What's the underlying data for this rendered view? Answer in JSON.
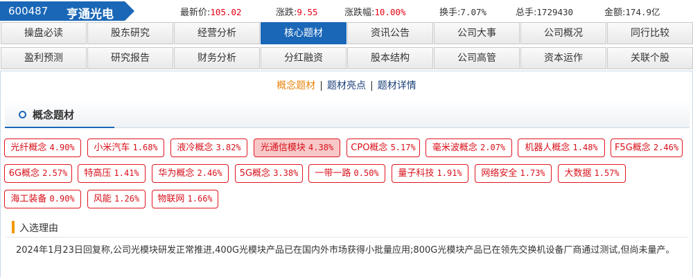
{
  "header": {
    "code": "600487",
    "name": "亨通光电",
    "quotes": [
      {
        "label": "最新价:",
        "value": "105.02",
        "color": "red"
      },
      {
        "label": "涨跌:",
        "value": "9.55",
        "color": "red"
      },
      {
        "label": "涨跌幅:",
        "value": "10.00%",
        "color": "red"
      },
      {
        "label": "换手:",
        "value": "7.07%",
        "color": "dark"
      },
      {
        "label": "总手:",
        "value": "1729430",
        "color": "dark"
      },
      {
        "label": "金额:",
        "value": "174.9亿",
        "color": "dark"
      }
    ]
  },
  "nav": {
    "row1": [
      "操盘必读",
      "股东研究",
      "经营分析",
      "核心题材",
      "资讯公告",
      "公司大事",
      "公司概况",
      "同行比较"
    ],
    "row2": [
      "盈利预测",
      "研究报告",
      "财务分析",
      "分红融资",
      "股本结构",
      "公司高管",
      "资本运作",
      "关联个股"
    ],
    "active": "核心题材"
  },
  "subnav": {
    "items": [
      "概念题材",
      "题材亮点",
      "题材详情"
    ],
    "separator": "|",
    "active": "概念题材"
  },
  "section": {
    "title": "概念题材"
  },
  "tags": [
    {
      "name": "光纤概念",
      "pct": "4.90%"
    },
    {
      "name": "小米汽车",
      "pct": "1.68%"
    },
    {
      "name": "液冷概念",
      "pct": "3.82%"
    },
    {
      "name": "光通信模块",
      "pct": "4.38%",
      "highlight": true
    },
    {
      "name": "CPO概念",
      "pct": "5.17%"
    },
    {
      "name": "毫米波概念",
      "pct": "2.07%"
    },
    {
      "name": "机器人概念",
      "pct": "1.48%"
    },
    {
      "name": "F5G概念",
      "pct": "2.46%"
    },
    {
      "name": "6G概念",
      "pct": "2.57%"
    },
    {
      "name": "特高压",
      "pct": "1.41%"
    },
    {
      "name": "华为概念",
      "pct": "2.46%"
    },
    {
      "name": "5G概念",
      "pct": "3.38%"
    },
    {
      "name": "一带一路",
      "pct": "0.50%"
    },
    {
      "name": "量子科技",
      "pct": "1.91%"
    },
    {
      "name": "网络安全",
      "pct": "1.73%"
    },
    {
      "name": "大数据",
      "pct": "1.57%"
    },
    {
      "name": "海工装备",
      "pct": "0.90%"
    },
    {
      "name": "风能",
      "pct": "1.26%"
    },
    {
      "name": "物联网",
      "pct": "1.66%"
    }
  ],
  "reason": {
    "title": "入选理由",
    "text": "2024年1月23日回复称,公司光模块研发正常推进,400G光模块产品已在国内外市场获得小批量应用;800G光模块产品已在领先交换机设备厂商通过测试,但尚未量产。"
  },
  "colors": {
    "brand_blue": "#1a67b7",
    "up_red": "#e60012",
    "subnav_active": "#e8850c",
    "reason_bar": "#f39800"
  }
}
